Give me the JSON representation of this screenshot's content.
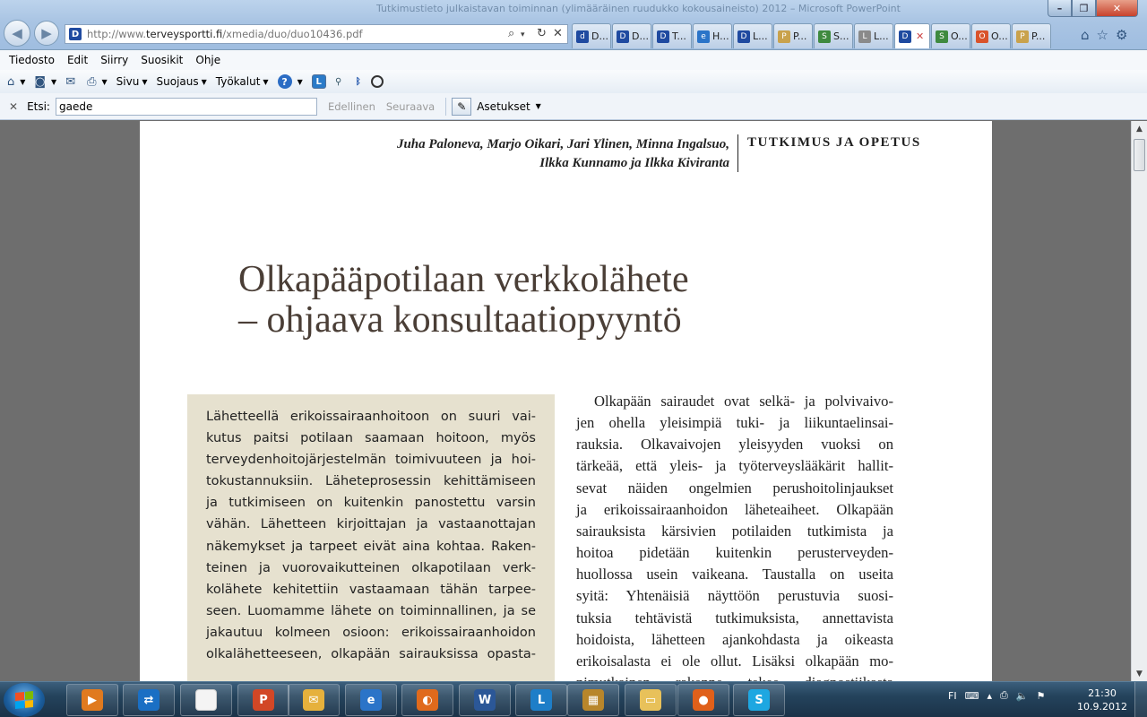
{
  "window": {
    "title": "Tutkimustieto julkaistavan toiminnan (ylimääräinen ruudukko kokousaineisto) 2012 – Microsoft PowerPoint",
    "minimize": "–",
    "maximize": "❐",
    "close": "✕"
  },
  "address": {
    "favicon": "D",
    "url_prefix": "http://www.",
    "url_domain": "terveysportti.fi",
    "url_path": "/xmedia/duo/duo10436.pdf",
    "tools": [
      "search-icon",
      "refresh-icon",
      "stop-icon"
    ]
  },
  "tabs": [
    {
      "label": "D...",
      "icon": "d",
      "color": "#1f4aa0"
    },
    {
      "label": "D...",
      "icon": "D",
      "color": "#1f4aa0"
    },
    {
      "label": "T...",
      "icon": "D",
      "color": "#1f4aa0"
    },
    {
      "label": "H...",
      "icon": "e",
      "color": "#2b74c8"
    },
    {
      "label": "L...",
      "icon": "D",
      "color": "#1f4aa0"
    },
    {
      "label": "P...",
      "icon": "P",
      "color": "#c9a24c"
    },
    {
      "label": "S...",
      "icon": "S",
      "color": "#3f8a3f"
    },
    {
      "label": "L...",
      "icon": "L",
      "color": "#8a8a8a"
    },
    {
      "label": "",
      "icon": "D",
      "color": "#1f4aa0",
      "active": true,
      "close": "✕"
    },
    {
      "label": "O...",
      "icon": "S",
      "color": "#3f8a3f"
    },
    {
      "label": "O...",
      "icon": "O",
      "color": "#d9532c"
    },
    {
      "label": "P...",
      "icon": "P",
      "color": "#c9a24c"
    }
  ],
  "right_icons": [
    "home-icon",
    "star-icon",
    "gear-icon"
  ],
  "menubar": [
    "Tiedosto",
    "Edit",
    "Siirry",
    "Suosikit",
    "Ohje"
  ],
  "commandbar": {
    "sivu": "Sivu",
    "suojaus": "Suojaus",
    "tyokalut": "Työkalut",
    "help": "?"
  },
  "findbar": {
    "close": "✕",
    "label": "Etsi:",
    "value": "gaede",
    "previous": "Edellinen",
    "next": "Seuraava",
    "options": "Asetukset"
  },
  "document": {
    "authors_line1": "Juha Paloneva, Marjo Oikari, Jari Ylinen, Minna Ingalsuo,",
    "authors_line2": "Ilkka Kunnamo ja Ilkka Kiviranta",
    "section": "TUTKIMUS JA OPETUS",
    "title_line1": "Olkapääpotilaan verkkolähete",
    "title_line2": "– ohjaava konsultaatiopyyntö",
    "abstract_lines": [
      "Lähetteellä erikoissairaanhoitoon on suuri vai-",
      "kutus paitsi potilaan saamaan hoitoon, myös",
      "terveydenhoitojärjestelmän toimivuuteen ja hoi-",
      "tokustannuksiin. Läheteprosessin kehittämiseen",
      "ja tutkimiseen on kuitenkin panostettu varsin",
      "vähän. Lähetteen kirjoittajan ja vastaanottajan",
      "näkemykset ja tarpeet eivät aina kohtaa. Raken-",
      "teinen ja vuorovaikutteinen olkapotilaan verk-",
      "kolähete kehitettiin vastaamaan tähän tarpee-",
      "seen. Luomamme lähete on toiminnallinen, ja se",
      "jakautuu kolmeen osioon: erikoissairaanhoidon",
      "olkalähetteeseen, olkapään sairauksissa opasta-"
    ],
    "body_lines": [
      "Olkapään sairaudet ovat selkä- ja polvivaivo-",
      "jen ohella yleisimpiä tuki- ja liikuntaelinsai-",
      "rauksia. Olkavaivojen yleisyyden vuoksi on",
      "tärkeää, että yleis- ja työterveyslääkärit hallit-",
      "sevat näiden ongelmien perushoitolinjaukset",
      "ja erikoissairaanhoidon läheteaiheet. Olkapään",
      "sairauksista kärsivien potilaiden tutkimista ja",
      "hoitoa pidetään kuitenkin perusterveyden-",
      "huollossa usein vaikeana. Taustalla on useita",
      "syitä: Yhtenäisiä näyttöön perustuvia suosi-",
      "tuksia tehtävistä tutkimuksista, annettavista",
      "hoidoista, lähetteen ajankohdasta ja oikeasta",
      "erikoisalasta ei ole ollut. Lisäksi olkapään mo-",
      "nimutkainen rakenne tekee diagnostiikasta"
    ]
  },
  "taskbar": {
    "items": [
      {
        "name": "media-player-icon",
        "glyph": "▶",
        "color": "#e07a1f"
      },
      {
        "name": "teamviewer-icon",
        "glyph": "⇄",
        "color": "#1a6fc4"
      },
      {
        "name": "blank-document-icon",
        "glyph": "",
        "color": "#f4f4f4"
      },
      {
        "name": "powerpoint-icon",
        "glyph": "P",
        "color": "#d24726"
      },
      {
        "name": "outlook-icon",
        "glyph": "✉",
        "color": "#e6b13c"
      },
      {
        "name": "internet-explorer-icon",
        "glyph": "e",
        "color": "#2b74c8"
      },
      {
        "name": "app-orange-icon",
        "glyph": "◐",
        "color": "#e06a1c"
      },
      {
        "name": "word-icon",
        "glyph": "W",
        "color": "#2b5797"
      },
      {
        "name": "lync-icon",
        "glyph": "L",
        "color": "#1e7ec8"
      },
      {
        "name": "calculator-icon",
        "glyph": "▦",
        "color": "#b8862b"
      },
      {
        "name": "explorer-folder-icon",
        "glyph": "▭",
        "color": "#e8c15a"
      },
      {
        "name": "firefox-icon",
        "glyph": "●",
        "color": "#e0601a"
      },
      {
        "name": "skype-icon",
        "glyph": "S",
        "color": "#1ea7e1"
      }
    ],
    "lang": "FI",
    "time": "21:30",
    "date": "10.9.2012"
  }
}
